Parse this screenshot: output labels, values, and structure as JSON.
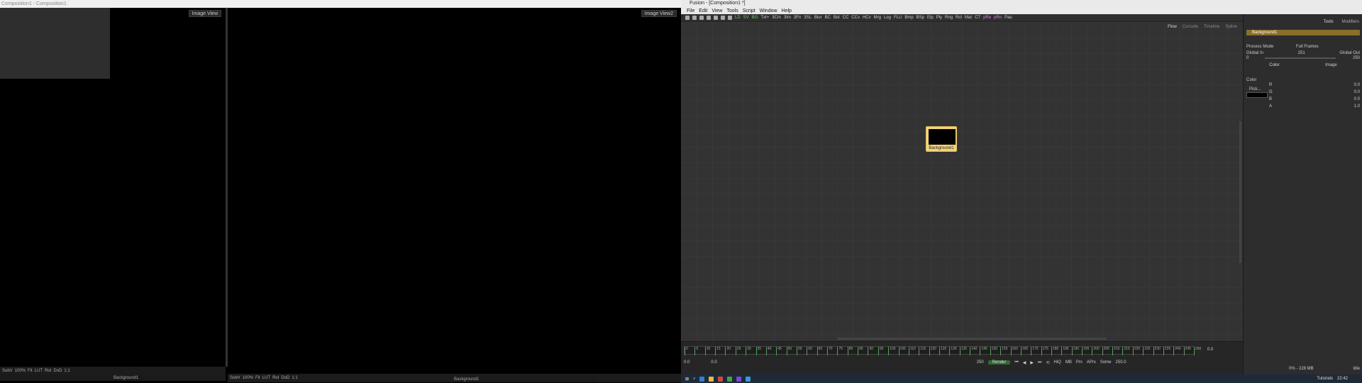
{
  "left_window": {
    "title": "Composition1 - Composition1",
    "viewer1_label": "Image View",
    "viewer2_label": "Image View2",
    "toolbar1": [
      "SubV",
      "100%",
      "Fit",
      "LUT",
      "RoI",
      "DoD",
      "1:1"
    ],
    "toolbar2": [
      "SubV",
      "100%",
      "Fit",
      "LUT",
      "RoI",
      "DoD",
      "1:1"
    ],
    "status1": "Background1",
    "status2": "Background1"
  },
  "fusion": {
    "title": "Fusion - [Composition1 *]",
    "menu": [
      "File",
      "Edit",
      "View",
      "Tools",
      "Script",
      "Window",
      "Help"
    ],
    "tool_buttons": [
      "LD",
      "SV",
      "BG",
      "Txt+",
      "3Cm",
      "3Im",
      "3Fn",
      "3SL",
      "Blur",
      "BC",
      "Bol",
      "CC",
      "CCv",
      "HCv",
      "Mrg",
      "Log",
      "FLU",
      "Bmp",
      "BSp",
      "Elp",
      "Ply",
      "Rng",
      "Rct",
      "Mat",
      "CT",
      "pRe",
      "pRn",
      "Pau"
    ],
    "flow_tabs": [
      "Flow",
      "Console",
      "Timeline",
      "Spline"
    ],
    "node_label": "Background1",
    "timeline_ticks": [
      "0",
      "5",
      "10",
      "15",
      "20",
      "25",
      "30",
      "35",
      "40",
      "45",
      "50",
      "55",
      "60",
      "65",
      "70",
      "75",
      "80",
      "85",
      "90",
      "95",
      "100",
      "105",
      "110",
      "115",
      "120",
      "125",
      "130",
      "135",
      "140",
      "145",
      "150",
      "155",
      "160",
      "165",
      "170",
      "175",
      "180",
      "185",
      "190",
      "195",
      "200",
      "205",
      "210",
      "215",
      "220",
      "225",
      "230",
      "235",
      "240",
      "245",
      "250"
    ],
    "timeline_values": {
      "start": "0.0",
      "current": "0.0",
      "render_start": "250",
      "end": "250.0",
      "current_time": "0.0"
    },
    "render_label": "Render",
    "quality_buttons": [
      "HiQ",
      "MB",
      "Prx",
      "APrx",
      "Some"
    ]
  },
  "inspector": {
    "tabs": [
      "Tools",
      "Modifiers"
    ],
    "node_header": "Background1",
    "sub_tabs": [
      "Color",
      "Image"
    ],
    "process_mode_label": "Process Mode",
    "process_mode_value": "Full Frames",
    "global_in_label": "Global In",
    "global_out_label": "Global Out",
    "global_in": "0",
    "global_out": "250",
    "global_mid": "251",
    "color_label": "Color",
    "pick_label": "Pick...",
    "channels": [
      {
        "name": "R",
        "value": "0.0"
      },
      {
        "name": "G",
        "value": "0.0"
      },
      {
        "name": "B",
        "value": "0.0"
      },
      {
        "name": "A",
        "value": "1.0"
      }
    ]
  },
  "status_bar": {
    "memory": "0% - 228 MB",
    "state": "Idle"
  },
  "taskbar": {
    "tutorials": "Tutorials",
    "time": "22:42"
  },
  "colors": {
    "node_fill": "#f2d27a",
    "render_green": "#2f6b2f",
    "inspector_header": "#8a6e2a"
  }
}
